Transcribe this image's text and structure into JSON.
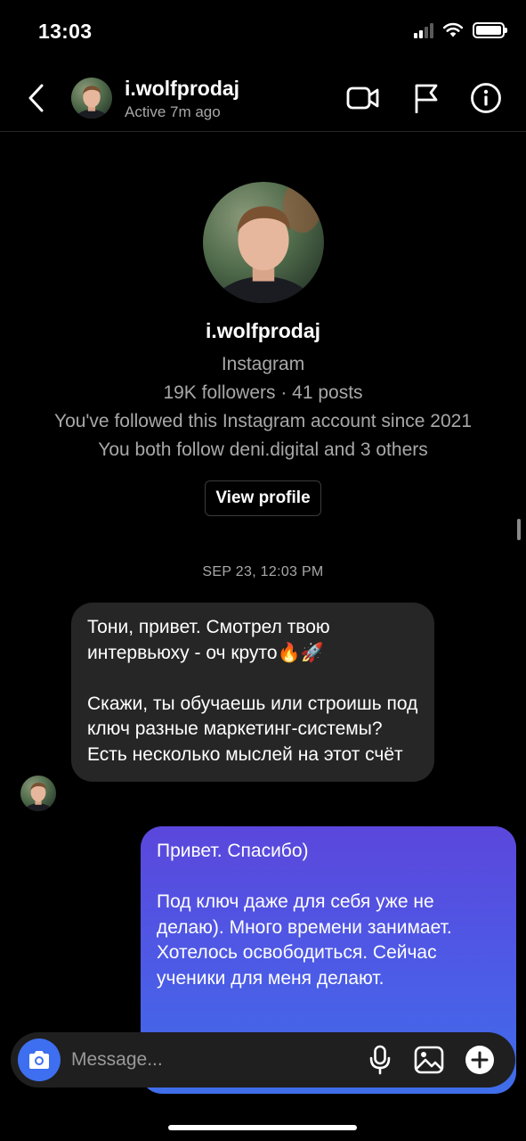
{
  "status_bar": {
    "time": "13:03",
    "icons": [
      "signal-icon",
      "wifi-icon",
      "battery-icon"
    ]
  },
  "header": {
    "username": "i.wolfprodaj",
    "status": "Active 7m ago",
    "icons": [
      "back-chevron-icon",
      "video-call-icon",
      "flag-icon",
      "info-icon"
    ]
  },
  "profile": {
    "username": "i.wolfprodaj",
    "platform": "Instagram",
    "stats": "19K followers · 41 posts",
    "followed_since": "You've followed this Instagram account since 2021",
    "mutual": "You both follow deni.digital and 3 others",
    "view_profile_label": "View profile"
  },
  "conversation": {
    "timestamp": "SEP 23, 12:03 PM",
    "incoming": {
      "paragraph1": "Тони, привет. Смотрел твою интервьюху - оч круто🔥🚀",
      "paragraph2": "Скажи, ты обучаешь или строишь под ключ разные маркетинг-системы? Есть несколько мыслей на этот счёт"
    },
    "outgoing": {
      "paragraph1": "Привет. Спасибо)",
      "paragraph2": "Под ключ даже для себя уже не делаю). Много времени занимает. Хотелось освободиться. Сейчас ученики для меня делают."
    }
  },
  "composer": {
    "placeholder": "Message...",
    "icons": [
      "camera-icon",
      "microphone-icon",
      "gallery-icon",
      "plus-icon"
    ]
  },
  "colors": {
    "background": "#000000",
    "incoming_bubble": "#262626",
    "outgoing_gradient": [
      "#5b47dc",
      "#3f6eea"
    ],
    "camera_button": "#3d6ff0",
    "secondary_text": "#a8a8a8"
  }
}
